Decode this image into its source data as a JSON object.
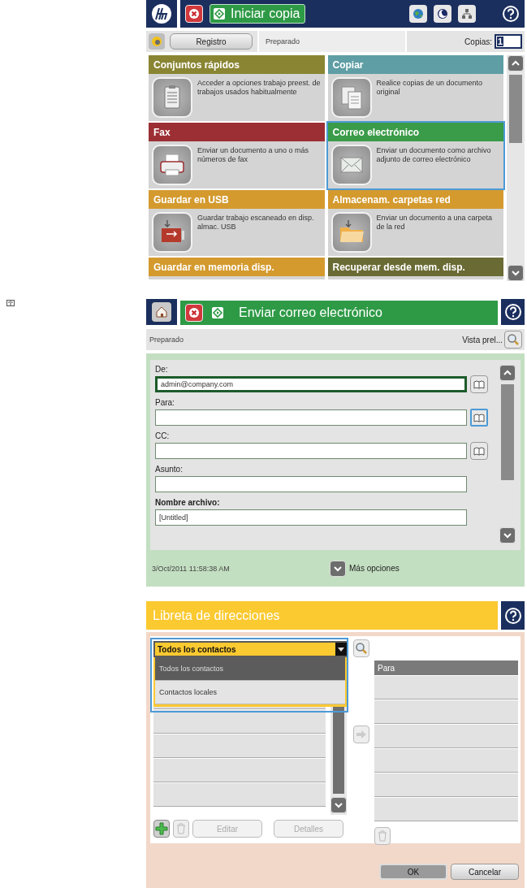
{
  "home_screen": {
    "header": {
      "start_label": "Iniciar copia"
    },
    "toolbar": {
      "log_button": "Registro",
      "status": "Preparado",
      "copies_label": "Copias:",
      "copies_value": "1"
    },
    "tiles": [
      {
        "title": "Conjuntos rápidos",
        "description": "Acceder a opciones trabajo preest. de trabajos usados habitualmente",
        "color": "#8a8533",
        "highlighted": false
      },
      {
        "title": "Copiar",
        "description": "Realice copias de un documento original",
        "color": "#5e9ea4",
        "highlighted": false
      },
      {
        "title": "Fax",
        "description": "Enviar un documento a uno o más números de fax",
        "color": "#9c2f34",
        "highlighted": false
      },
      {
        "title": "Correo electrónico",
        "description": "Enviar un documento como archivo adjunto de correo electrónico",
        "color": "#3a9b48",
        "highlighted": true
      },
      {
        "title": "Guardar en USB",
        "description": "Guardar trabajo escaneado en disp. almac. USB",
        "color": "#d49a2e",
        "highlighted": false
      },
      {
        "title": "Almacenam. carpetas red",
        "description": "Enviar un documento a una carpeta de la red",
        "color": "#d49a2e",
        "highlighted": false
      },
      {
        "title": "Guardar en memoria disp.",
        "color": "#d49a2e",
        "highlighted": false
      },
      {
        "title": "Recuperar desde mem. disp.",
        "color": "#6a6a34",
        "highlighted": false
      }
    ]
  },
  "email_screen": {
    "title": "Enviar correo electrónico",
    "status": "Preparado",
    "preview_label": "Vista prel...",
    "fields": [
      {
        "label": "De:",
        "value": "admin@company.com",
        "active": true,
        "address_book": true,
        "highlighted": false,
        "emphasized": false
      },
      {
        "label": "Para:",
        "active": false,
        "address_book": true,
        "highlighted": true,
        "emphasized": false
      },
      {
        "label": "CC:",
        "active": false,
        "address_book": true,
        "highlighted": false,
        "emphasized": false
      },
      {
        "label": "Asunto:",
        "active": false,
        "address_book": false,
        "emphasized": false
      },
      {
        "label": "Nombre archivo:",
        "value": "[Untitled]",
        "active": false,
        "address_book": false,
        "emphasized": true
      }
    ],
    "datetime": "3/Oct/2011 11:58:38 AM",
    "more_options": "Más opciones"
  },
  "address_book": {
    "title": "Libreta de direcciones",
    "dropdown": {
      "value": "Todos los contactos",
      "expanded": true,
      "highlighted": true,
      "options": [
        {
          "label": "Todos los contactos",
          "selected": true
        },
        {
          "label": "Contactos locales",
          "selected": false
        }
      ]
    },
    "recipients_header": "Para",
    "edit_button": "Editar",
    "details_button": "Detalles",
    "ok_button": "OK",
    "cancel_button": "Cancelar"
  }
}
